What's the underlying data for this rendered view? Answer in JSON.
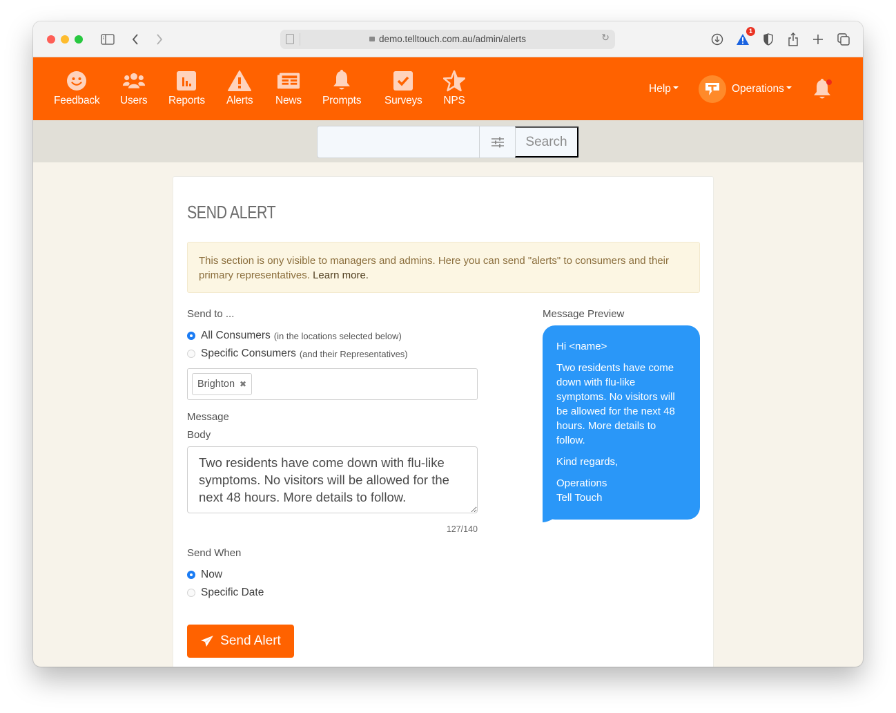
{
  "browser": {
    "url": "demo.telltouch.com.au/admin/alerts",
    "alert_badge_count": "1",
    "icons": [
      "sidebar-icon",
      "back-icon",
      "forward-icon",
      "reader-icon",
      "lock-icon",
      "reload-icon",
      "download-icon",
      "warning-icon",
      "shield-icon",
      "share-icon",
      "new-tab-icon",
      "tabs-overview-icon"
    ]
  },
  "nav": {
    "items": [
      {
        "label": "Feedback",
        "icon": "smiley-icon"
      },
      {
        "label": "Users",
        "icon": "users-icon"
      },
      {
        "label": "Reports",
        "icon": "bar-chart-icon"
      },
      {
        "label": "Alerts",
        "icon": "warning-icon"
      },
      {
        "label": "News",
        "icon": "newspaper-icon"
      },
      {
        "label": "Prompts",
        "icon": "bell-icon"
      },
      {
        "label": "Surveys",
        "icon": "checkbox-icon"
      },
      {
        "label": "NPS",
        "icon": "star-icon"
      }
    ],
    "help_label": "Help",
    "account_label": "Operations",
    "brand_color": "#ff6200"
  },
  "search": {
    "value": "",
    "placeholder": "",
    "button_label": "Search"
  },
  "page": {
    "title": "SEND ALERT",
    "info_text": "This section is ony visible to managers and admins. Here you can send \"alerts\" to consumers and their primary representatives.",
    "info_link": "Learn more.",
    "send_to": {
      "label": "Send to ...",
      "options": [
        {
          "label": "All Consumers",
          "hint": "(in the locations selected below)",
          "checked": true
        },
        {
          "label": "Specific Consumers",
          "hint": "(and their Representatives)",
          "checked": false
        }
      ],
      "locations": [
        "Brighton"
      ]
    },
    "message": {
      "section_label": "Message",
      "body_label": "Body",
      "body_value": "Two residents have come down with flu-like symptoms. No visitors will be allowed for the next 48 hours. More details to follow.",
      "char_count": "127/140"
    },
    "send_when": {
      "label": "Send When",
      "options": [
        {
          "label": "Now",
          "checked": true
        },
        {
          "label": "Specific Date",
          "checked": false
        }
      ]
    },
    "send_button_label": "Send Alert",
    "preview": {
      "label": "Message Preview",
      "greeting": "Hi <name>",
      "body": "Two residents have come down with flu-like symptoms. No visitors will be allowed for the next 48 hours. More details to follow.",
      "closing": "Kind regards,",
      "signature_line1": "Operations",
      "signature_line2": "Tell Touch",
      "bubble_color": "#2a97f8"
    }
  }
}
